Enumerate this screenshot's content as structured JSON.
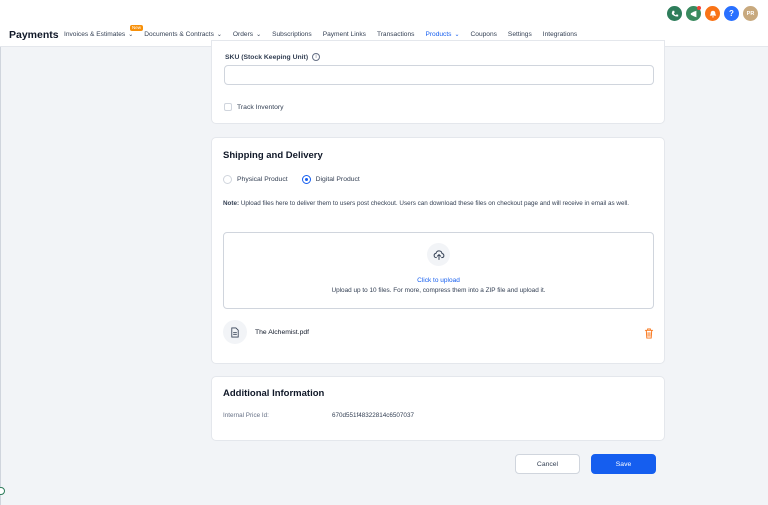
{
  "header": {
    "brand": "Payments",
    "nav": [
      {
        "label": "Invoices & Estimates",
        "chevron": true,
        "badge": "New"
      },
      {
        "label": "Documents & Contracts",
        "chevron": true
      },
      {
        "label": "Orders",
        "chevron": true
      },
      {
        "label": "Subscriptions"
      },
      {
        "label": "Payment Links"
      },
      {
        "label": "Transactions"
      },
      {
        "label": "Products",
        "chevron": true,
        "active": true
      },
      {
        "label": "Coupons"
      },
      {
        "label": "Settings"
      },
      {
        "label": "Integrations"
      }
    ],
    "icons": [
      "phone-icon",
      "megaphone-icon",
      "bell-icon",
      "help-icon"
    ],
    "avatar_initials": "PR"
  },
  "sku": {
    "label": "SKU (Stock Keeping Unit)",
    "info_glyph": "i",
    "value": "",
    "track_inventory_label": "Track Inventory"
  },
  "shipping": {
    "title": "Shipping and Delivery",
    "option_physical": "Physical Product",
    "option_digital": "Digital Product",
    "selected": "digital",
    "note_prefix": "Note:",
    "note_text": " Upload files here to deliver them to users post checkout. Users can download these files on checkout page and will receive in email as well.",
    "upload_link": "Click to upload",
    "upload_hint": "Upload up to 10 files. For more, compress them into a ZIP file and upload it.",
    "file_name": "The Alchemist.pdf"
  },
  "additional": {
    "title": "Additional Information",
    "price_id_label": "Internal Price Id:",
    "price_id_value": "670d551f48322814c6507037"
  },
  "actions": {
    "cancel": "Cancel",
    "save": "Save"
  },
  "colors": {
    "primary": "#155eef",
    "danger": "#f97316"
  }
}
